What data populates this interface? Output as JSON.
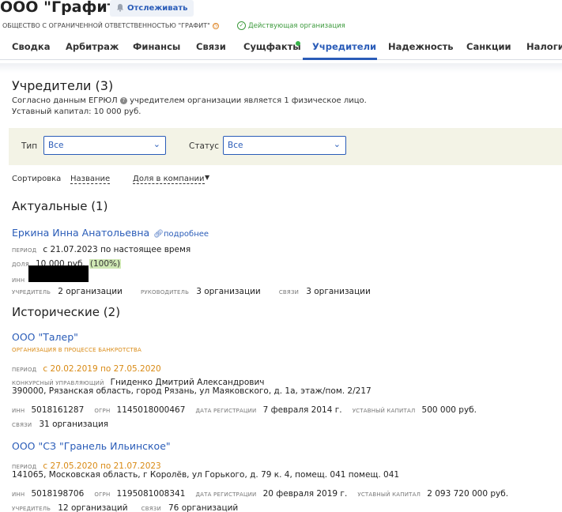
{
  "header": {
    "title": "ООО \"Графит\"",
    "track_label": "Отслеживать",
    "full_name": "ОБЩЕСТВО С ОГРАНИЧЕННОЙ ОТВЕТСТВЕННОСТЬЮ \"ГРАФИТ\"",
    "status": "Действующая организация"
  },
  "tabs": [
    "Сводка",
    "Арбитраж",
    "Финансы",
    "Связи",
    "Сущфакты",
    "Учредители",
    "Надежность",
    "Санкции",
    "Налоги"
  ],
  "active_tab": "Учредители",
  "section": {
    "title": "Учредители (3)",
    "desc_prefix": "Согласно данным ЕГРЮЛ",
    "desc_suffix": "учредителем организации является 1 физическое лицо.",
    "capital": "Уставный капитал: 10 000 руб."
  },
  "filters": {
    "type_label": "Тип",
    "type_value": "Все",
    "status_label": "Статус",
    "status_value": "Все"
  },
  "sort": {
    "label": "Сортировка",
    "name": "Название",
    "share": "Доля в компании"
  },
  "actual": {
    "heading": "Актуальные (1)",
    "name": "Еркина Инна Анатольевна",
    "more": "подробнее",
    "period_label": "период",
    "period": "с 21.07.2023 по настоящее время",
    "share_label": "доля",
    "share": "10 000 руб.",
    "share_pct": "(100%)",
    "inn_label": "инн",
    "founder_label": "учредитель",
    "founder_value": "2 организации",
    "head_label": "руководитель",
    "head_value": "3 организации",
    "links_label": "связи",
    "links_value": "3 организации"
  },
  "historical": {
    "heading": "Исторические (2)",
    "items": [
      {
        "name": "ООО \"Талер\"",
        "badge": "организация в процессе банкротства",
        "period_label": "период",
        "period": "с 20.02.2019 по 27.05.2020",
        "manager_label": "конкурсный управляющий",
        "manager": "Гниденко Дмитрий Александрович",
        "address": "390000, Рязанская область, город Рязань, ул Маяковского, д. 1а, этаж/пом. 2/217",
        "inn_label": "инн",
        "inn": "5018161287",
        "ogrn_label": "огрн",
        "ogrn": "1145018000467",
        "reg_label": "дата регистрации",
        "reg": "7 февраля 2014 г.",
        "cap_label": "уставный капитал",
        "cap": "500 000 руб.",
        "links_label": "связи",
        "links_value": "31 организация"
      },
      {
        "name": "ООО \"СЗ \"Гранель Ильинское\"",
        "period_label": "период",
        "period": "с 27.05.2020 по 21.07.2023",
        "address": "141065, Московская область, г Королёв, ул Горького, д. 79 к. 4, помещ. 041 помещ. 041",
        "inn_label": "инн",
        "inn": "5018198706",
        "ogrn_label": "огрн",
        "ogrn": "1195081008341",
        "reg_label": "дата регистрации",
        "reg": "20 февраля 2019 г.",
        "cap_label": "уставный капитал",
        "cap": "2 093 720 000 руб.",
        "founder_label": "учредитель",
        "founder_value": "12 организаций",
        "links_label": "связи",
        "links_value": "76 организаций"
      }
    ]
  },
  "colors": {
    "link": "#2a5cb8",
    "accent_orange": "#d98a14",
    "status_green": "#3c9a3c",
    "filter_bg": "#f3f3e6"
  }
}
